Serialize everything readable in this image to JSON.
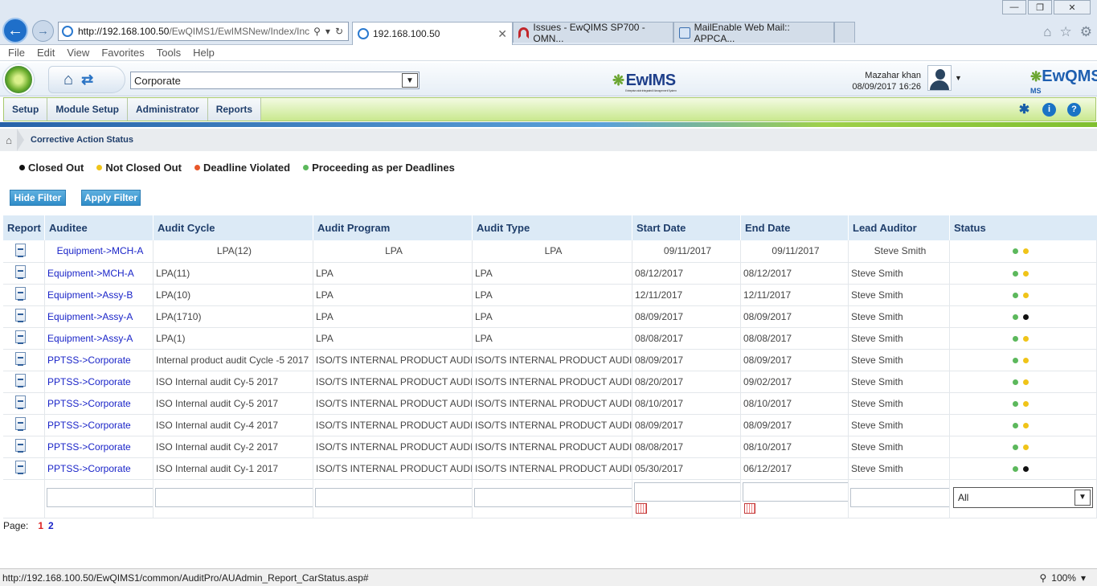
{
  "browser": {
    "address_host": "http://192.168.100.50",
    "address_path": "/EwQIMS1/EwIMSNew/Index/Inc",
    "tabs": [
      {
        "label": "192.168.100.50"
      },
      {
        "label": "Issues - EwQIMS SP700 - OMN..."
      },
      {
        "label": "MailEnable Web Mail:: APPCA..."
      }
    ],
    "menu": [
      "File",
      "Edit",
      "View",
      "Favorites",
      "Tools",
      "Help"
    ],
    "status_url": "http://192.168.100.50/EwQIMS1/common/AuditPro/AUAdmin_Report_CarStatus.asp#",
    "zoom": "100%"
  },
  "header": {
    "org_selected": "Corporate",
    "brand": "EwIMS",
    "brand_tagline": "Enterprise wide Integrated Management System",
    "user_name": "Mazahar khan",
    "user_datetime": "08/09/2017 16:26",
    "brand_right": "EwQMS",
    "brand_right_sup": "I MS"
  },
  "nav": [
    "Setup",
    "Module Setup",
    "Administrator",
    "Reports"
  ],
  "breadcrumb": {
    "title": "Corrective Action Status"
  },
  "legend": [
    {
      "label": "Closed Out",
      "color": "#111111"
    },
    {
      "label": "Not Closed Out",
      "color": "#f0c419"
    },
    {
      "label": "Deadline Violated",
      "color": "#e8572a"
    },
    {
      "label": "Proceeding as per Deadlines",
      "color": "#5cb85c"
    }
  ],
  "buttons": {
    "hide_filter": "Hide Filter",
    "apply_filter": "Apply Filter"
  },
  "table": {
    "columns": [
      "Report",
      "Auditee",
      "Audit Cycle",
      "Audit Program",
      "Audit Type",
      "Start Date",
      "End Date",
      "Lead Auditor",
      "Status"
    ],
    "rows": [
      {
        "auditee": "Equipment->MCH-A",
        "cycle": "LPA(12)",
        "program": "LPA",
        "type": "LPA",
        "start": "09/11/2017",
        "end": "09/11/2017",
        "lead": "Steve Smith",
        "status": [
          "#5cb85c",
          "#f0c419"
        ]
      },
      {
        "auditee": "Equipment->MCH-A",
        "cycle": "LPA(11)",
        "program": "LPA",
        "type": "LPA",
        "start": "08/12/2017",
        "end": "08/12/2017",
        "lead": "Steve Smith",
        "status": [
          "#5cb85c",
          "#f0c419"
        ]
      },
      {
        "auditee": "Equipment->Assy-B",
        "cycle": "LPA(10)",
        "program": "LPA",
        "type": "LPA",
        "start": "12/11/2017",
        "end": "12/11/2017",
        "lead": "Steve Smith",
        "status": [
          "#5cb85c",
          "#f0c419"
        ]
      },
      {
        "auditee": "Equipment->Assy-A",
        "cycle": "LPA(1710)",
        "program": "LPA",
        "type": "LPA",
        "start": "08/09/2017",
        "end": "08/09/2017",
        "lead": "Steve Smith",
        "status": [
          "#5cb85c",
          "#111111"
        ]
      },
      {
        "auditee": "Equipment->Assy-A",
        "cycle": "LPA(1)",
        "program": "LPA",
        "type": "LPA",
        "start": "08/08/2017",
        "end": "08/08/2017",
        "lead": "Steve Smith",
        "status": [
          "#5cb85c",
          "#f0c419"
        ]
      },
      {
        "auditee": "PPTSS->Corporate",
        "cycle": "Internal product audit Cycle -5 2017",
        "program": "ISO/TS INTERNAL PRODUCT AUDIT",
        "type": "ISO/TS INTERNAL PRODUCT AUDIT",
        "start": "08/09/2017",
        "end": "08/09/2017",
        "lead": "Steve Smith",
        "status": [
          "#5cb85c",
          "#f0c419"
        ]
      },
      {
        "auditee": "PPTSS->Corporate",
        "cycle": "ISO Internal audit Cy-5 2017",
        "program": "ISO/TS INTERNAL PRODUCT AUDIT",
        "type": "ISO/TS INTERNAL PRODUCT AUDIT",
        "start": "08/20/2017",
        "end": "09/02/2017",
        "lead": "Steve Smith",
        "status": [
          "#5cb85c",
          "#f0c419"
        ]
      },
      {
        "auditee": "PPTSS->Corporate",
        "cycle": "ISO Internal audit Cy-5 2017",
        "program": "ISO/TS INTERNAL PRODUCT AUDIT",
        "type": "ISO/TS INTERNAL PRODUCT AUDIT",
        "start": "08/10/2017",
        "end": "08/10/2017",
        "lead": "Steve Smith",
        "status": [
          "#5cb85c",
          "#f0c419"
        ]
      },
      {
        "auditee": "PPTSS->Corporate",
        "cycle": "ISO Internal audit Cy-4 2017",
        "program": "ISO/TS INTERNAL PRODUCT AUDIT",
        "type": "ISO/TS INTERNAL PRODUCT AUDIT",
        "start": "08/09/2017",
        "end": "08/09/2017",
        "lead": "Steve Smith",
        "status": [
          "#5cb85c",
          "#f0c419"
        ]
      },
      {
        "auditee": "PPTSS->Corporate",
        "cycle": "ISO Internal audit Cy-2 2017",
        "program": "ISO/TS INTERNAL PRODUCT AUDIT",
        "type": "ISO/TS INTERNAL PRODUCT AUDIT",
        "start": "08/08/2017",
        "end": "08/10/2017",
        "lead": "Steve Smith",
        "status": [
          "#5cb85c",
          "#f0c419"
        ]
      },
      {
        "auditee": "PPTSS->Corporate",
        "cycle": "ISO Internal audit Cy-1 2017",
        "program": "ISO/TS INTERNAL PRODUCT AUDIT",
        "type": "ISO/TS INTERNAL PRODUCT AUDIT",
        "start": "05/30/2017",
        "end": "06/12/2017",
        "lead": "Steve Smith",
        "status": [
          "#5cb85c",
          "#111111"
        ]
      }
    ],
    "status_filter": "All"
  },
  "pager": {
    "label": "Page:",
    "pages": [
      "1",
      "2"
    ]
  }
}
